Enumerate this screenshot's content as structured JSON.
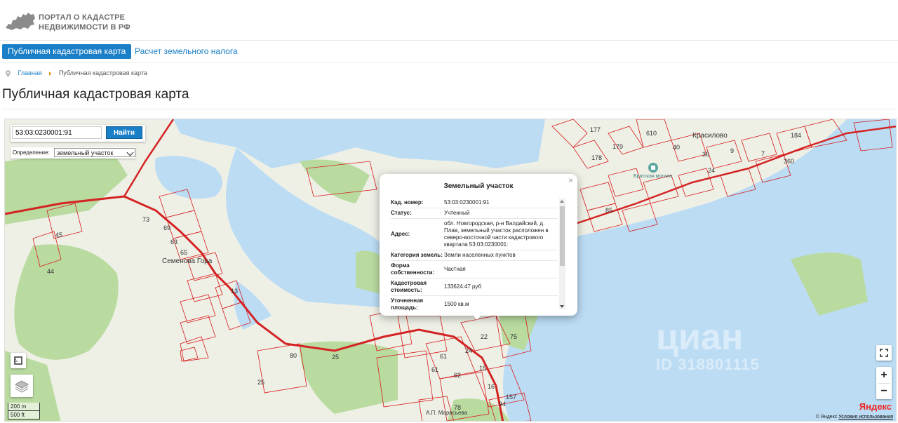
{
  "header": {
    "logo_line1": "ПОРТАЛ О КАДАСТРЕ",
    "logo_line2": "НЕДВИЖИМОСТИ В РФ"
  },
  "nav": {
    "tab_active": "Публичная кадастровая карта",
    "tab_link": "Расчет земельного налога"
  },
  "breadcrumb": {
    "home": "Главная",
    "current": "Публичная кадастровая карта"
  },
  "page_title": "Публичная кадастровая карта",
  "map": {
    "search_value": "53:03:0230001:91",
    "search_button": "Найти",
    "definition_label": "Определение:",
    "definition_value": "земельный участок",
    "popup": {
      "title": "Земельный участок",
      "rows": [
        {
          "key": "Кад. номер:",
          "value": "53:03:0230001:91"
        },
        {
          "key": "Статус:",
          "value": "Учтенный"
        },
        {
          "key": "Адрес:",
          "value": "обл. Новгородская, р-н Валдайский, д. Плав, земельный участок расположен в северо-восточной части кадастрового квартала 53:03:0230001:"
        },
        {
          "key": "Категория земель:",
          "value": "Земли населенных пунктов"
        },
        {
          "key": "Форма собственности:",
          "value": "Частная"
        },
        {
          "key": "Кадастровая стоимость:",
          "value": "133624.47 руб"
        },
        {
          "key": "Уточненная площадь:",
          "value": "1500 кв.м"
        }
      ]
    },
    "labels": {
      "village1": "Семенова Гора",
      "village2": "Красилово",
      "church": "Братская могила",
      "person": "А.П. Маресьева"
    },
    "scale_metric": "200 m",
    "scale_imperial": "500 ft",
    "zoom_in": "+",
    "zoom_out": "−",
    "yandex_logo": "Яндекс",
    "copyright_prefix": "© Яндекс",
    "copyright_link": "Условия использования",
    "watermark": "циан",
    "watermark_id": "ID 318801115",
    "parcel_numbers": [
      "45",
      "44",
      "73",
      "69",
      "63",
      "65",
      "13",
      "80",
      "25",
      "25",
      "22",
      "24",
      "75",
      "61",
      "61",
      "62",
      "15",
      "16",
      "157",
      "94",
      "78",
      "610",
      "177",
      "179",
      "178",
      "40",
      "36",
      "24",
      "9",
      "7",
      "184",
      "360",
      "85"
    ]
  },
  "colors": {
    "accent": "#1a7fc7",
    "water": "#bcdcf4",
    "forest": "#b9dba0",
    "boundary": "#d81b1b"
  }
}
